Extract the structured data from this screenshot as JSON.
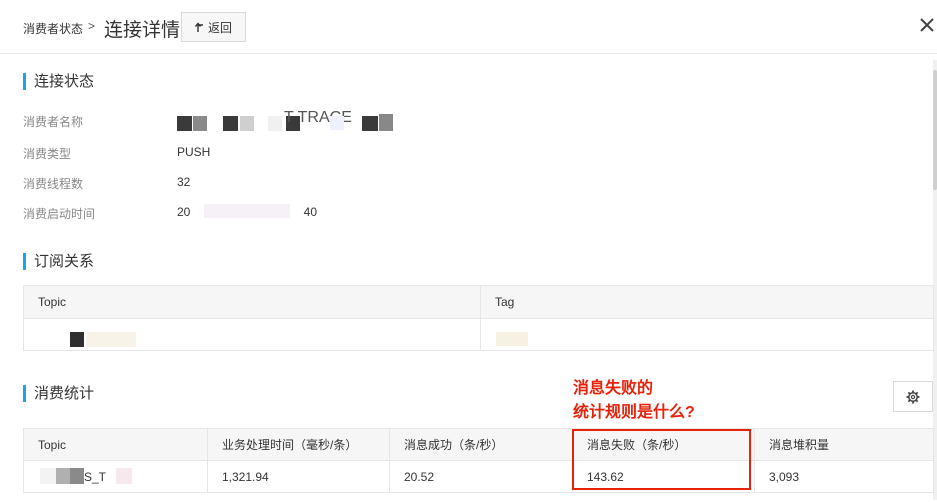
{
  "header": {
    "breadcrumb_parent": "消费者状态",
    "breadcrumb_sep": ">",
    "title": "连接详情",
    "back_label": "返回"
  },
  "connection": {
    "section_title": "连接状态",
    "fields": [
      {
        "label": "消费者名称",
        "value": "T TRACE"
      },
      {
        "label": "消费类型",
        "value": "PUSH"
      },
      {
        "label": "消费线程数",
        "value": "32"
      },
      {
        "label": "消费启动时间",
        "value": "20 40"
      }
    ]
  },
  "subscription": {
    "section_title": "订阅关系",
    "columns": [
      "Topic",
      "Tag"
    ],
    "rows": [
      [
        "",
        ""
      ]
    ]
  },
  "stats": {
    "section_title": "消费统计",
    "columns": [
      "Topic",
      "业务处理时间（毫秒/条）",
      "消息成功（条/秒）",
      "消息失败（条/秒）",
      "消息堆积量"
    ],
    "rows": [
      [
        "S_T",
        "1,321.94",
        "20.52",
        "143.62",
        "3,093"
      ]
    ]
  },
  "annotation": {
    "line1": "消息失败的",
    "line2": "统计规则是什么?"
  },
  "colors": {
    "accent": "#1ba5e6",
    "annotation": "#e8220b"
  },
  "icons": {
    "back": "back-arrow-icon",
    "close": "close-icon",
    "settings": "gear-icon"
  }
}
